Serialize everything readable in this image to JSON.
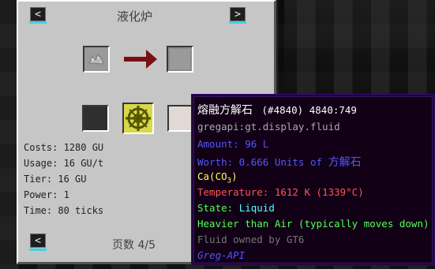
{
  "gui": {
    "title": "液化炉",
    "prev_label": "<",
    "next_label": ">",
    "page_label": "页数 4/5",
    "bottom_prev_label": "<"
  },
  "info": {
    "costs": "Costs: 1280 GU",
    "usage": "Usage: 16 GU/t",
    "tier": "Tier: 16 GU",
    "power": "Power: 1",
    "time": "Time: 80 ticks"
  },
  "tooltip": {
    "name": "熔融方解石",
    "id": "(#4840) 4840:749",
    "registry": "gregapi:gt.display.fluid",
    "amount": "Amount: 96 L",
    "worth_prefix": "Worth: 0.666 Units of ",
    "worth_material": "方解石",
    "formula_prefix": "Ca(CO",
    "formula_sub": "3",
    "formula_suffix": ")",
    "temperature": "Temperature: 1612 K (1339°C)",
    "state_prefix": "State: ",
    "state_value": "Liquid",
    "density": "Heavier than Air (typically moves down)",
    "owner": "Fluid owned by GT6",
    "mod": "Greg-API"
  },
  "colors": {
    "panel": "#c6c6c6",
    "tooltip_bg": "#110016",
    "tooltip_border": "#2d0a5c",
    "nav_accent": "#3fd0e8",
    "text_blue": "#5555ff",
    "text_yellow": "#ffff55",
    "text_red": "#ff5555",
    "text_green": "#55ff55",
    "text_gray": "#aaaaaa",
    "text_darkgray": "#777777"
  }
}
